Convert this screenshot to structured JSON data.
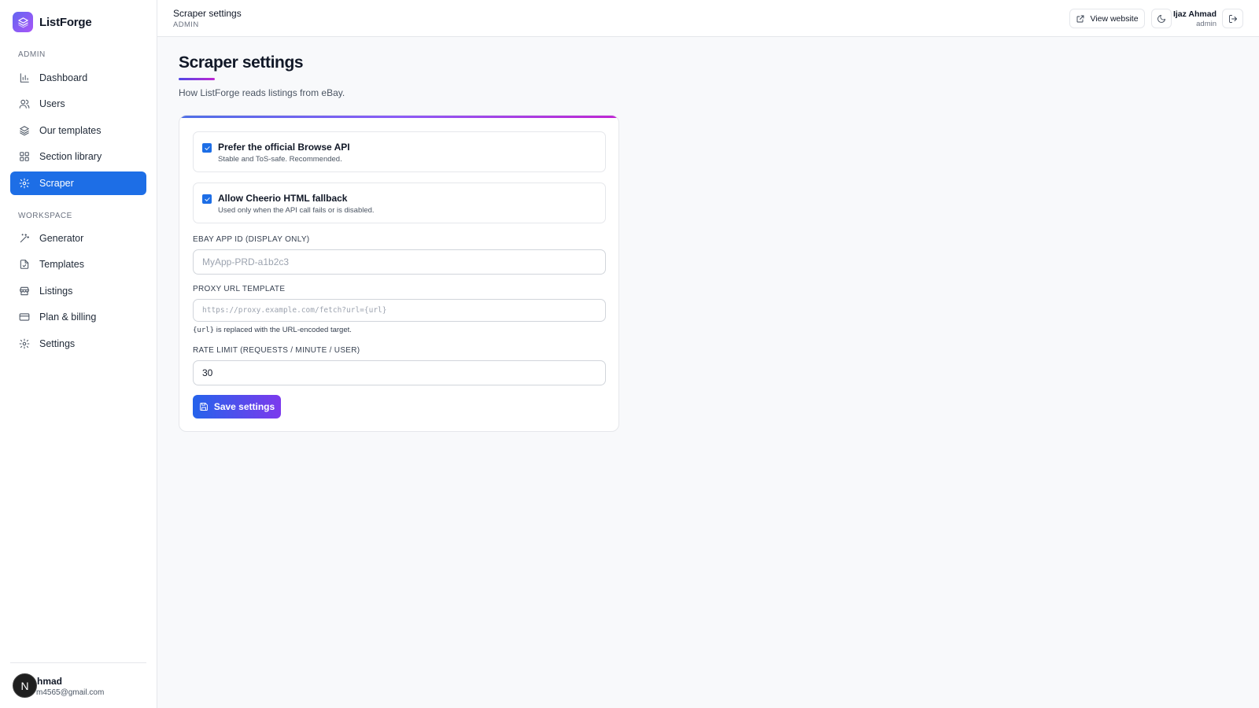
{
  "brand": {
    "name": "ListForge"
  },
  "sidebar": {
    "admin_label": "ADMIN",
    "workspace_label": "WORKSPACE",
    "admin_items": [
      {
        "label": "Dashboard",
        "icon": "bar-chart-icon"
      },
      {
        "label": "Users",
        "icon": "users-icon"
      },
      {
        "label": "Our templates",
        "icon": "layers-icon"
      },
      {
        "label": "Section library",
        "icon": "grid-icon"
      },
      {
        "label": "Scraper",
        "icon": "gear-icon",
        "active": true
      }
    ],
    "workspace_items": [
      {
        "label": "Generator",
        "icon": "magic-wand-icon"
      },
      {
        "label": "Templates",
        "icon": "file-icon"
      },
      {
        "label": "Listings",
        "icon": "store-icon"
      },
      {
        "label": "Plan & billing",
        "icon": "credit-card-icon"
      },
      {
        "label": "Settings",
        "icon": "gear-icon"
      }
    ],
    "user": {
      "name": "hmad",
      "email": "m4565@gmail.com",
      "avatar_letter": "N"
    }
  },
  "topbar": {
    "title": "Scraper settings",
    "subtitle": "ADMIN",
    "view_website": "View website",
    "user_name": "Ijaz Ahmad",
    "user_role": "admin"
  },
  "main": {
    "title": "Scraper settings",
    "subtitle": "How ListForge reads listings from eBay.",
    "options": [
      {
        "title": "Prefer the official Browse API",
        "desc": "Stable and ToS-safe. Recommended.",
        "checked": true
      },
      {
        "title": "Allow Cheerio HTML fallback",
        "desc": "Used only when the API call fails or is disabled.",
        "checked": true
      }
    ],
    "app_id": {
      "label": "EBAY APP ID (DISPLAY ONLY)",
      "placeholder": "MyApp-PRD-a1b2c3",
      "value": ""
    },
    "proxy": {
      "label": "PROXY URL TEMPLATE",
      "placeholder": "https://proxy.example.com/fetch?url={url}",
      "value": "",
      "hint_code": "{url}",
      "hint_text": " is replaced with the URL-encoded target."
    },
    "rate_limit": {
      "label": "RATE LIMIT (REQUESTS / MINUTE / USER)",
      "value": "30"
    },
    "save_label": "Save settings"
  },
  "colors": {
    "accent": "#1d6ee6",
    "gradient_start": "#2563eb",
    "gradient_end": "#7c3aed"
  }
}
